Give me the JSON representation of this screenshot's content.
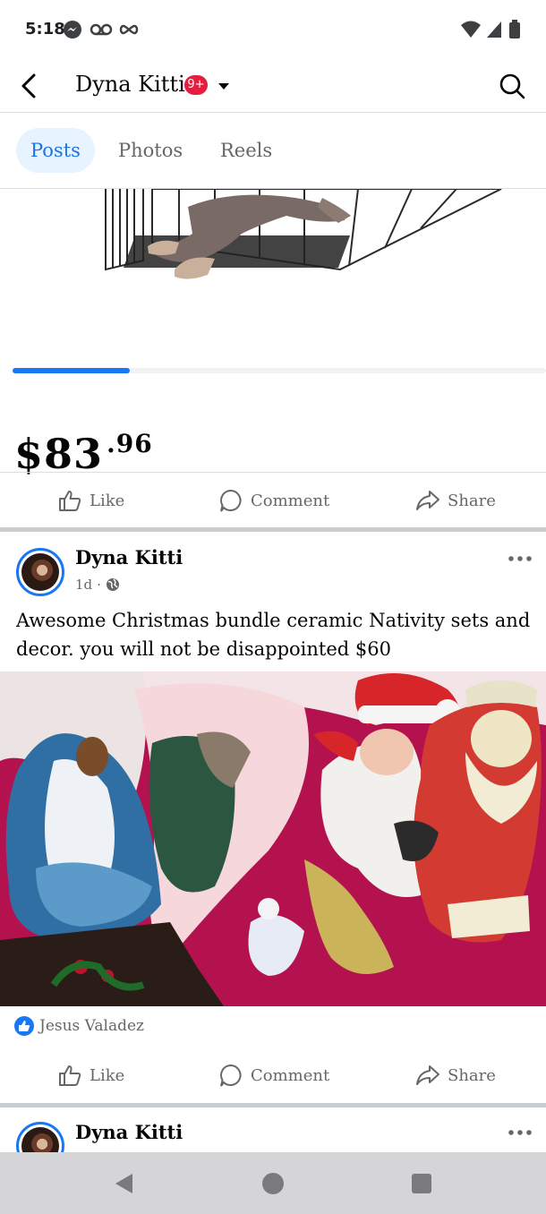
{
  "status_bar": {
    "time": "5:18",
    "left_icons": [
      "messenger-icon",
      "voicemail-icon",
      "infinity-icon"
    ],
    "right_icons": [
      "wifi-icon",
      "signal-icon",
      "battery-icon"
    ]
  },
  "header": {
    "title": "Dyna Kitti",
    "badge": "9+",
    "back_icon": "back-arrow-icon",
    "search_icon": "search-icon"
  },
  "tabs": [
    {
      "label": "Posts",
      "active": true
    },
    {
      "label": "Photos",
      "active": false
    },
    {
      "label": "Reels",
      "active": false
    }
  ],
  "previous_post": {
    "price_dollars": "$83",
    "price_cents": ".96",
    "carousel_progress": 0.22
  },
  "actions": {
    "like": "Like",
    "comment": "Comment",
    "share": "Share"
  },
  "post": {
    "author": "Dyna Kitti",
    "time": "1d",
    "privacy_icon": "globe-icon",
    "text": "Awesome Christmas bundle ceramic Nativity sets and decor. you will not be disappointed $60",
    "reactor": "Jesus Valadez"
  },
  "next_post": {
    "author": "Dyna Kitti"
  },
  "colors": {
    "accent": "#1877f2",
    "badge": "#e41e3f",
    "secondary_text": "#65676b",
    "divider": "#c9ccd1"
  }
}
